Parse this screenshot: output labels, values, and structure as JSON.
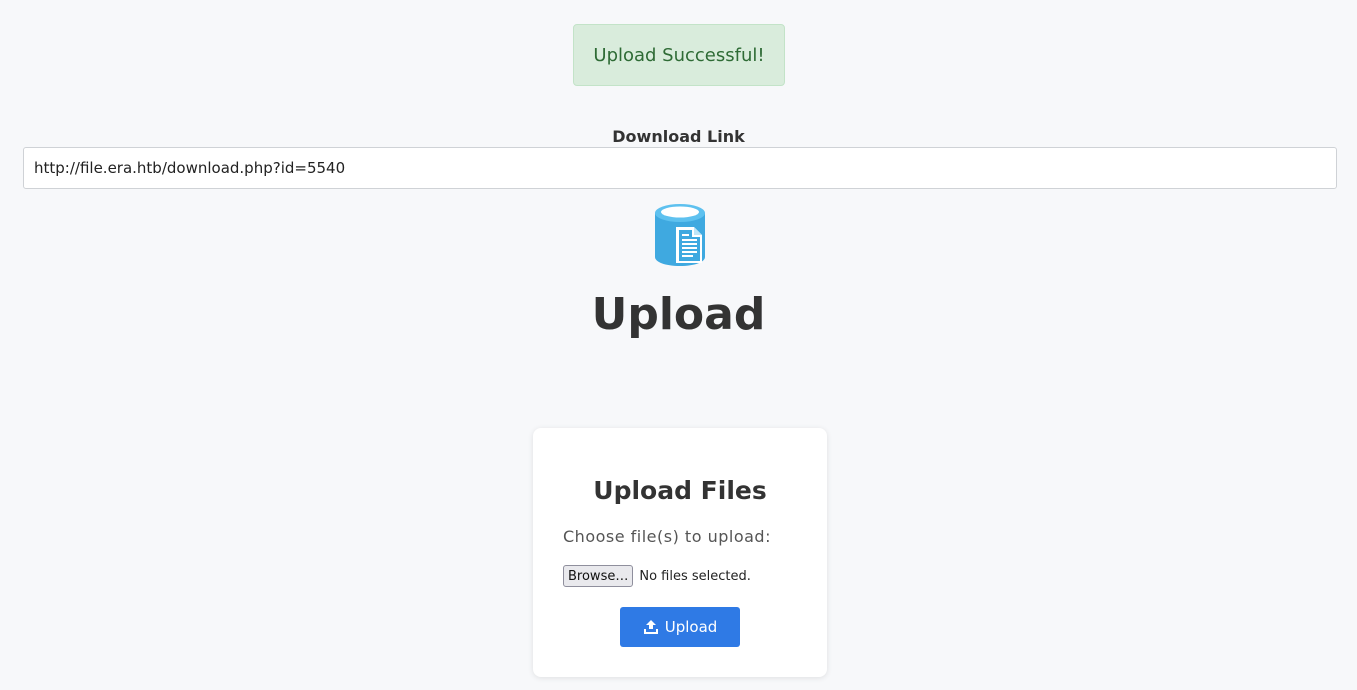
{
  "alert": {
    "message": "Upload Successful!",
    "background_color": "#d9ecdc",
    "text_color": "#2e6b35"
  },
  "download": {
    "label": "Download Link",
    "link_value": "http://file.era.htb/download.php?id=5540"
  },
  "page": {
    "title": "Upload",
    "logo_icon": "database-document-icon"
  },
  "card": {
    "title": "Upload Files",
    "choose_label": "Choose file(s) to upload:",
    "browse_label": "Browse…",
    "file_status": "No files selected.",
    "upload_button_label": "Upload",
    "upload_icon": "upload-icon",
    "accent_color": "#2f7ae5"
  }
}
